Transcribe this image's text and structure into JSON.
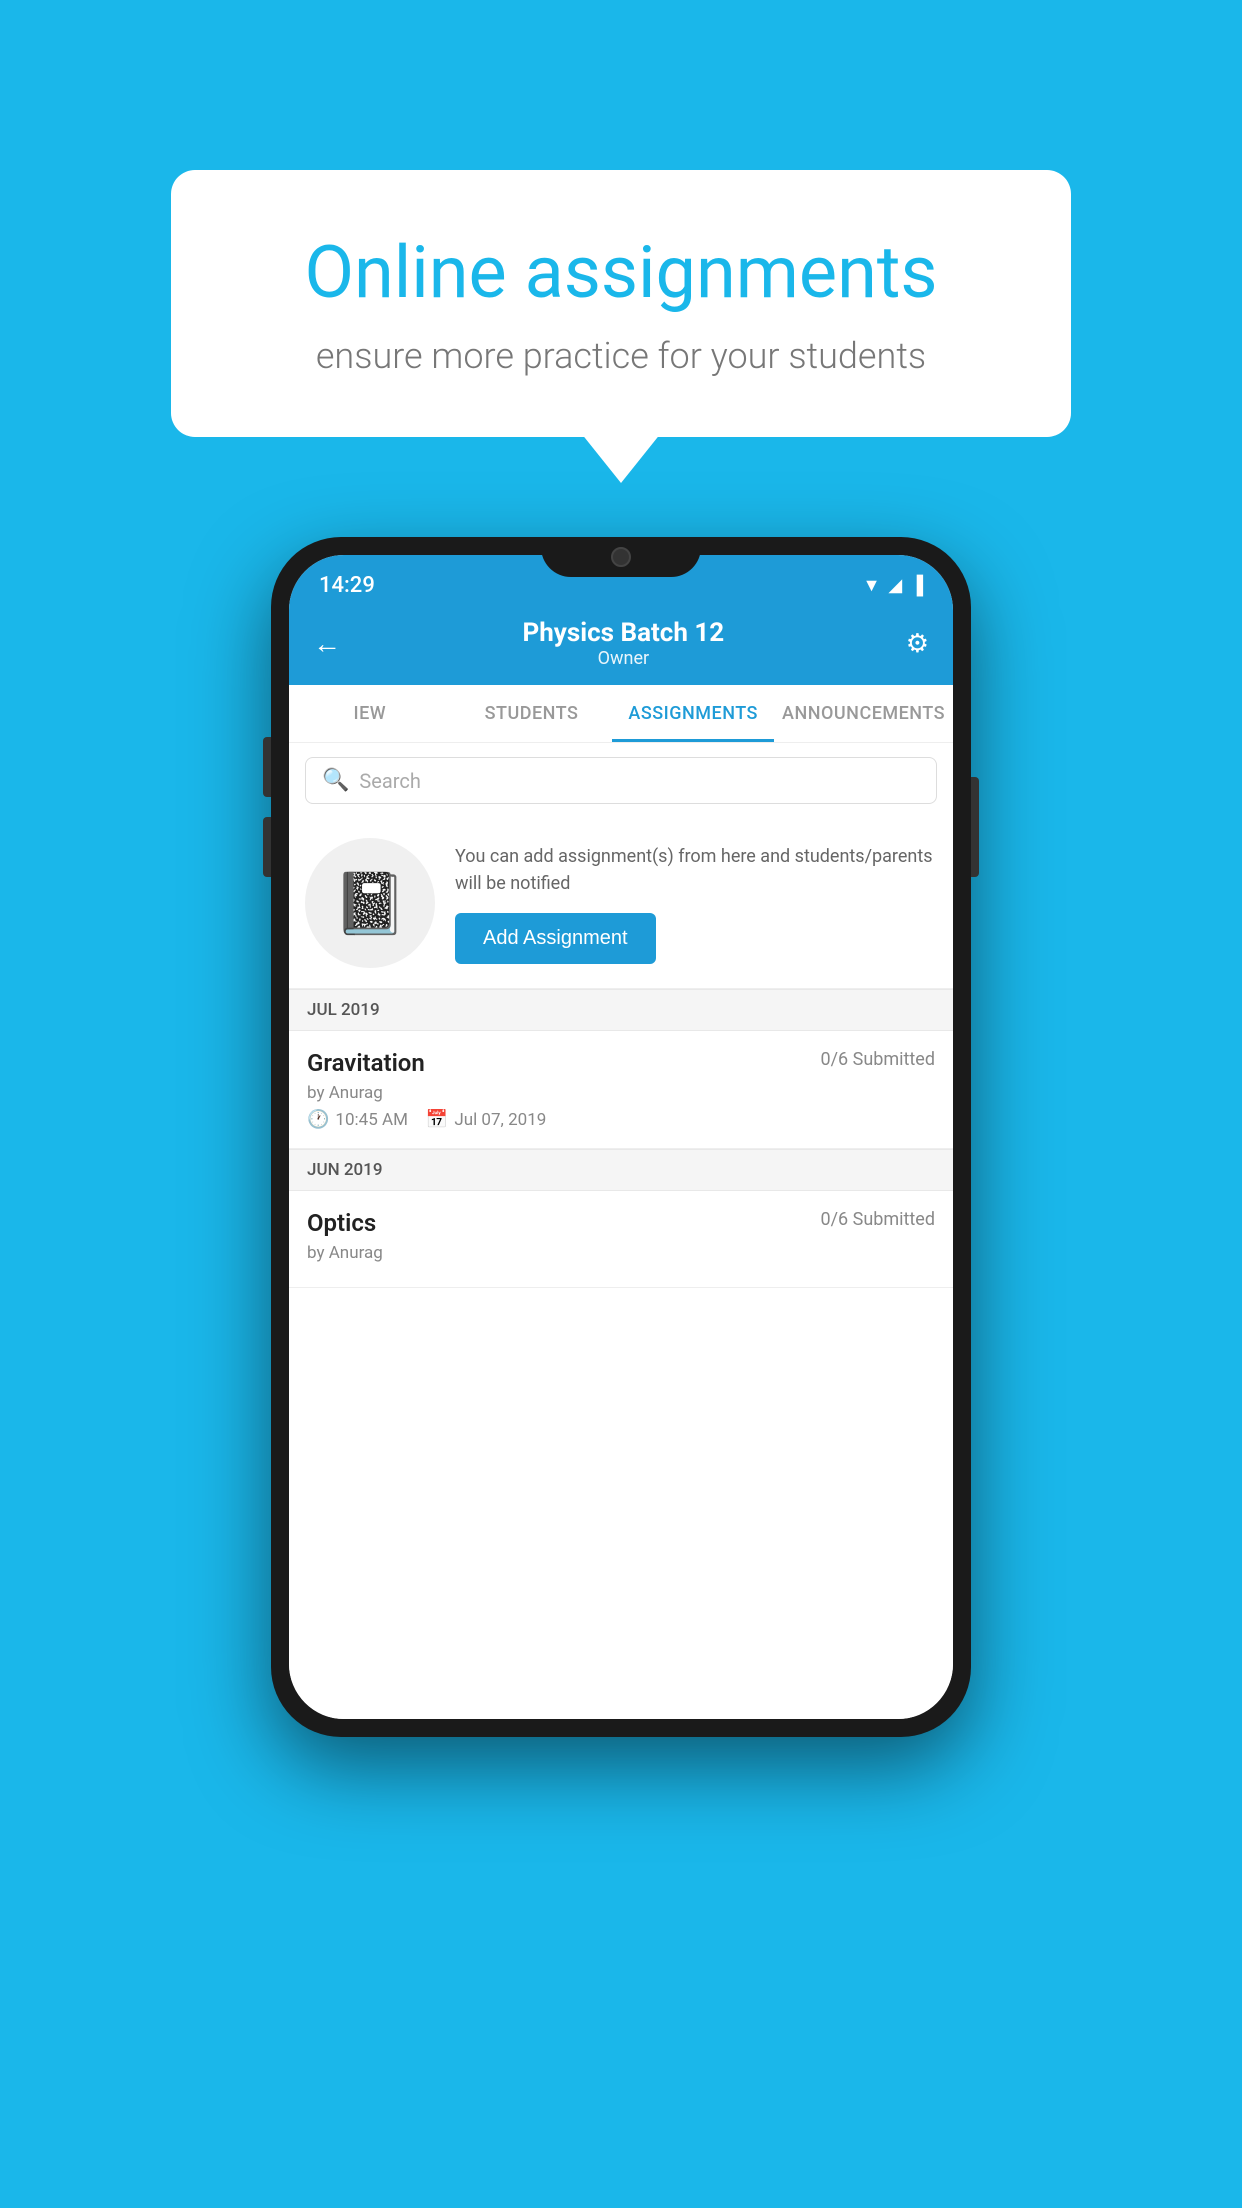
{
  "background_color": "#1ab7ea",
  "speech_bubble": {
    "title": "Online assignments",
    "subtitle": "ensure more practice for your students"
  },
  "phone": {
    "status_bar": {
      "time": "14:29",
      "icons": [
        "wifi",
        "signal",
        "battery"
      ]
    },
    "header": {
      "title": "Physics Batch 12",
      "subtitle": "Owner",
      "back_label": "←",
      "settings_label": "⚙"
    },
    "tabs": [
      {
        "label": "IEW",
        "active": false
      },
      {
        "label": "STUDENTS",
        "active": false
      },
      {
        "label": "ASSIGNMENTS",
        "active": true
      },
      {
        "label": "ANNOUNCEMENTS",
        "active": false
      }
    ],
    "search": {
      "placeholder": "Search"
    },
    "promo": {
      "icon": "📓",
      "text": "You can add assignment(s) from here and students/parents will be notified",
      "button_label": "Add Assignment"
    },
    "sections": [
      {
        "header": "JUL 2019",
        "assignments": [
          {
            "title": "Gravitation",
            "submitted": "0/6 Submitted",
            "by": "by Anurag",
            "time": "10:45 AM",
            "date": "Jul 07, 2019"
          }
        ]
      },
      {
        "header": "JUN 2019",
        "assignments": [
          {
            "title": "Optics",
            "submitted": "0/6 Submitted",
            "by": "by Anurag",
            "time": "",
            "date": ""
          }
        ]
      }
    ]
  }
}
